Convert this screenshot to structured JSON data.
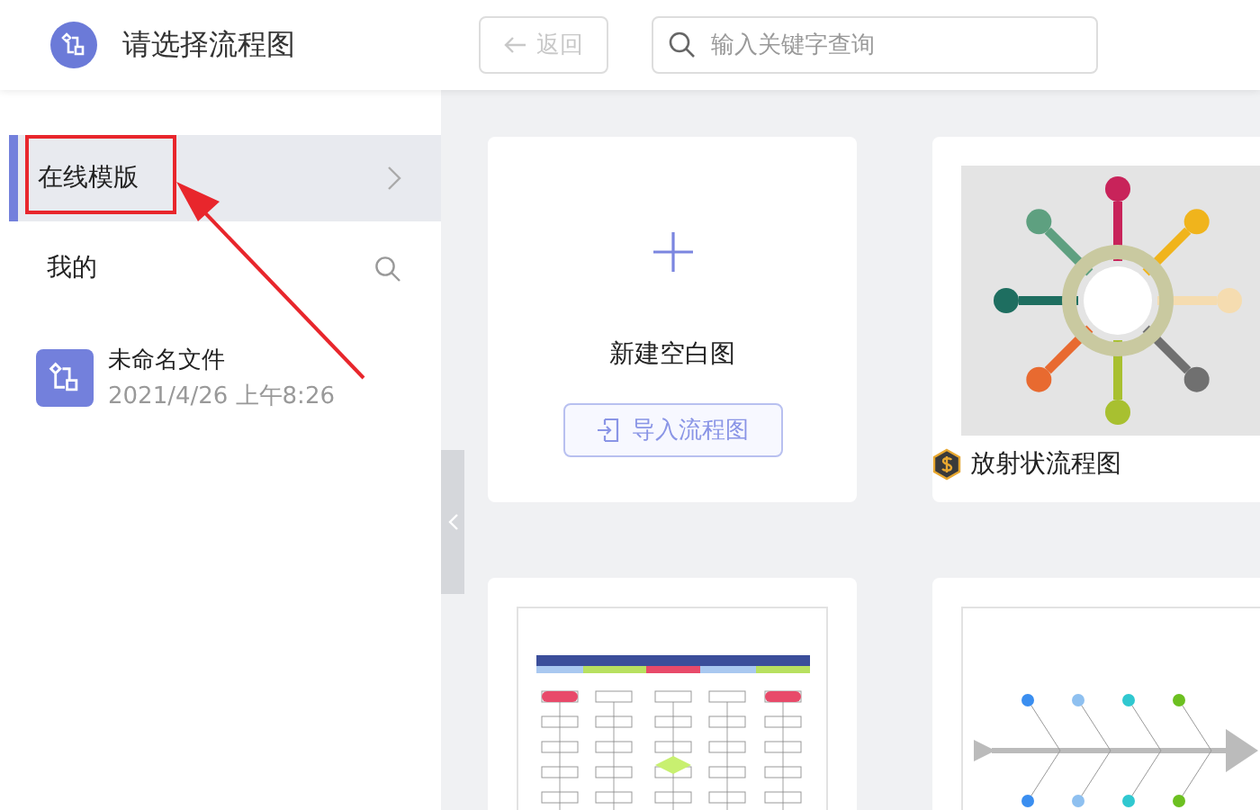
{
  "header": {
    "title": "请选择流程图",
    "back_button": {
      "label": "返回",
      "disabled": true
    },
    "search": {
      "placeholder": "输入关键字查询"
    }
  },
  "sidebar": {
    "items": [
      {
        "kind": "nav",
        "label": "在线模版",
        "selected": true
      },
      {
        "kind": "search",
        "label": "我的",
        "selected": false
      }
    ],
    "files": [
      {
        "name": "未命名文件",
        "date": "2021/4/26 上午8:26"
      }
    ]
  },
  "cards": [
    {
      "kind": "new",
      "label": "新建空白图",
      "button": "导入流程图"
    },
    {
      "kind": "radial",
      "label": "放射状流程图",
      "premium": true
    },
    {
      "kind": "flowchart"
    },
    {
      "kind": "fishbone"
    }
  ],
  "annotation": {
    "highlight": true,
    "arrow": true
  }
}
